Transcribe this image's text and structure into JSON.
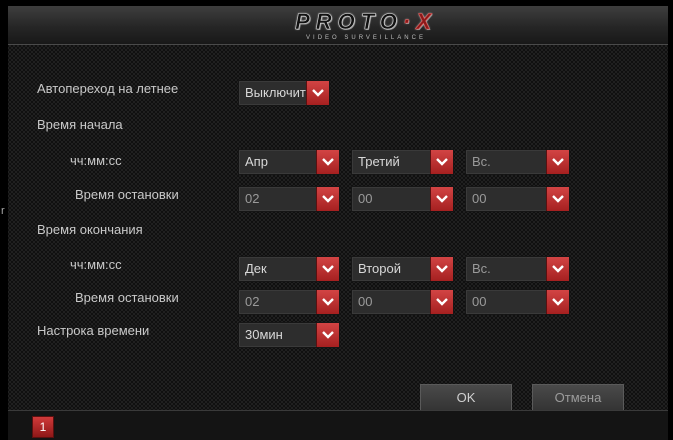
{
  "header": {
    "logo_main_a": "PROTO",
    "logo_main_b": "·X",
    "logo_sub": "VIDEO SURVEILLANCE"
  },
  "dst": {
    "auto_label": "Автопереход на летнее",
    "auto_value": "Выключить",
    "start_label": "Время начала",
    "start_date_label": "чч:мм:сс",
    "start_month": "Апр",
    "start_week": "Третий",
    "start_day": "Вс.",
    "start_time_label": "Время остановки",
    "start_hour": "02",
    "start_min": "00",
    "start_sec": "00",
    "end_label": "Время окончания",
    "end_date_label": "чч:мм:сс",
    "end_month": "Дек",
    "end_week": "Второй",
    "end_day": "Вс.",
    "end_time_label": "Время остановки",
    "end_hour": "02",
    "end_min": "00",
    "end_sec": "00",
    "offset_label": "Настрока времени",
    "offset_value": "30мин"
  },
  "buttons": {
    "ok": "OK",
    "cancel": "Отмена"
  },
  "footer": {
    "badge": "1"
  },
  "colors": {
    "accent": "#c0302f",
    "text": "#c9c9c9",
    "panel": "#202020"
  },
  "icons": {
    "dropdown": "chevron-down-icon"
  }
}
